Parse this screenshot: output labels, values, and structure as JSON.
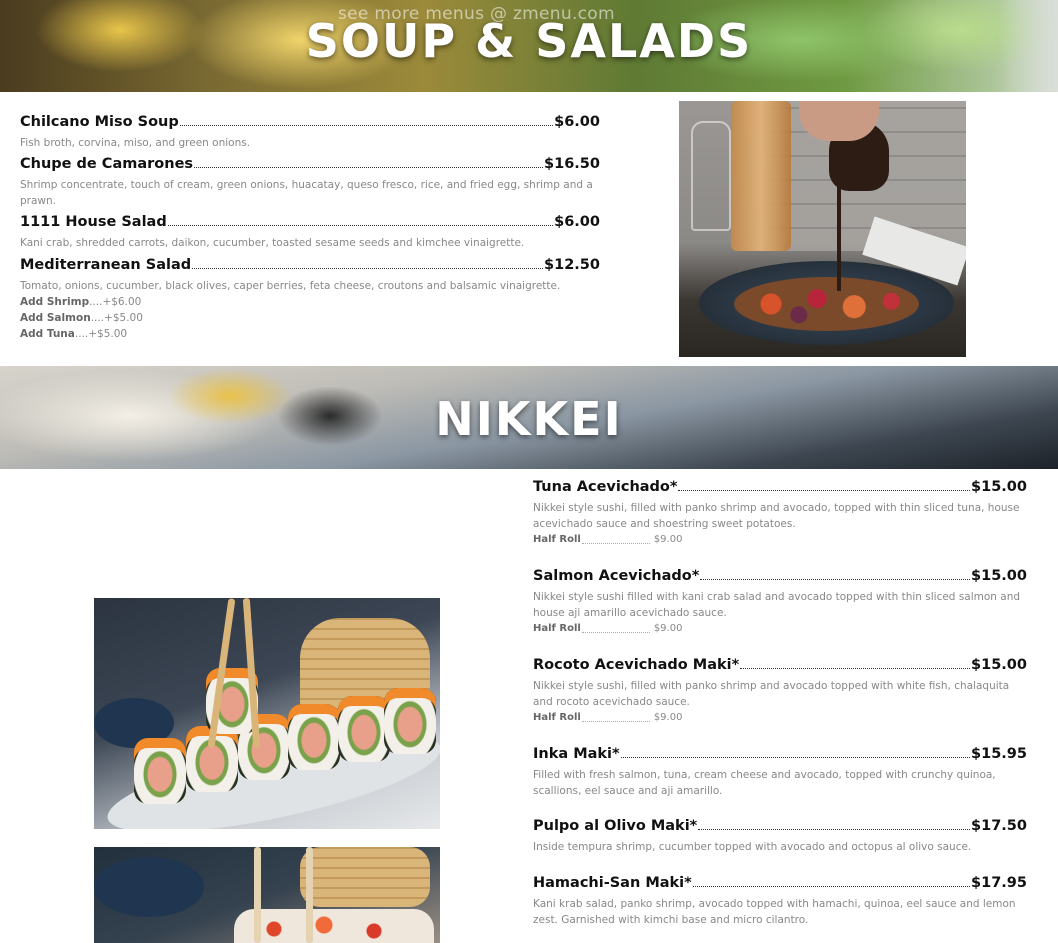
{
  "watermark": "see more menus @ zmenu.com",
  "soup_salads": {
    "title": "SOUP & SALADS",
    "items": [
      {
        "name": "Chilcano Miso Soup",
        "price": "$6.00",
        "description": "Fish broth, corvina, miso, and green onions."
      },
      {
        "name": "Chupe de Camarones",
        "price": "$16.50",
        "description": "Shrimp concentrate, touch of cream, green onions, huacatay, queso fresco, rice, and fried egg, shrimp and a prawn."
      },
      {
        "name": "1111 House Salad",
        "price": "$6.00",
        "description": "Kani crab, shredded carrots, daikon, cucumber, toasted sesame seeds and kimchee vinaigrette."
      },
      {
        "name": "Mediterranean Salad",
        "price": "$12.50",
        "description": "Tomato, onions, cucumber, black olives, caper berries, feta cheese, croutons and balsamic vinaigrette."
      }
    ],
    "addons": [
      {
        "name": "Add Shrimp",
        "price": "....+$6.00"
      },
      {
        "name": "Add Salmon",
        "price": "....+$5.00"
      },
      {
        "name": "Add Tuna",
        "price": "....+$5.00"
      }
    ]
  },
  "nikkei": {
    "title": "NIKKEI",
    "half_roll_label": "Half Roll",
    "items": [
      {
        "name": "Tuna Acevichado*",
        "price": "$15.00",
        "description": "Nikkei style sushi, filled with panko shrimp and avocado, topped with thin sliced tuna, house acevichado sauce and shoestring sweet potatoes.",
        "half_roll_price": "$9.00"
      },
      {
        "name": "Salmon Acevichado*",
        "price": "$15.00",
        "description": "Nikkei style sushi filled with kani crab salad and avocado topped with thin sliced salmon and house aji amarillo acevichado sauce.",
        "half_roll_price": "$9.00"
      },
      {
        "name": "Rocoto Acevichado Maki*",
        "price": "$15.00",
        "description": "Nikkei style sushi, filled with panko shrimp and avocado topped with white fish, chalaquita and rocoto acevichado sauce.",
        "half_roll_price": "$9.00"
      },
      {
        "name": "Inka Maki*",
        "price": "$15.95",
        "description": "Filled with fresh salmon, tuna, cream cheese and avocado, topped with crunchy quinoa, scallions, eel sauce and aji amarillo."
      },
      {
        "name": "Pulpo al Olivo Maki*",
        "price": "$17.50",
        "description": "Inside tempura shrimp, cucumber topped with avocado and octopus al olivo sauce."
      },
      {
        "name": "Hamachi-San Maki*",
        "price": "$17.95",
        "description": "Kani krab salad, panko shrimp, avocado topped with hamachi, quinoa, eel sauce and lemon zest. Garnished with kimchi base and micro cilantro."
      }
    ]
  }
}
